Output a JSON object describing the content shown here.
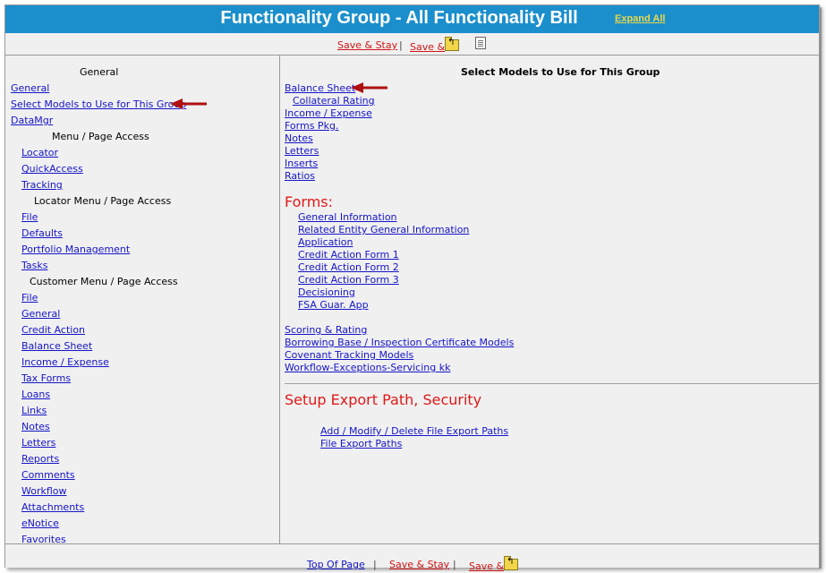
{
  "title": "Functionality Group - All Functionality Bill",
  "expand_all": "Expand All",
  "toolbar": {
    "save_stay": "Save & Stay",
    "sep": "|",
    "save": "Save &"
  },
  "left": {
    "general_heading": "General",
    "links_top": [
      "General",
      "Select Models to Use for This Group",
      "DataMgr"
    ],
    "menu_page_access": "Menu / Page Access",
    "menu_items": [
      "Locator",
      "QuickAccess",
      "Tracking"
    ],
    "locator_menu": "Locator Menu / Page Access",
    "locator_items": [
      "File",
      "Defaults",
      "Portfolio Management",
      "Tasks"
    ],
    "customer_menu": "Customer Menu / Page Access",
    "customer_items": [
      "File",
      "General",
      "Credit Action",
      "Balance Sheet",
      "Income / Expense",
      "Tax Forms",
      "Loans",
      "Links",
      "Notes",
      "Letters",
      "Reports",
      "Comments",
      "Workflow",
      "Attachments",
      "eNotice",
      "Favorites"
    ]
  },
  "right": {
    "heading": "Select Models to Use for This Group",
    "balance_sheet": "Balance Sheet",
    "collateral_rating": "Collateral Rating",
    "models": [
      "Income / Expense",
      "Forms Pkg.",
      "Notes",
      "Letters",
      "Inserts",
      "Ratios"
    ],
    "forms_heading": "Forms:",
    "forms": [
      "General Information",
      "Related Entity General Information",
      "Application",
      "Credit Action Form 1",
      "Credit Action Form 2",
      "Credit Action Form 3",
      "Decisioning",
      "FSA Guar. App"
    ],
    "more_models": [
      "Scoring & Rating",
      "Borrowing Base / Inspection Certificate Models",
      "Covenant Tracking Models",
      "Workflow-Exceptions-Servicing kk"
    ],
    "setup_heading": "Setup Export Path, Security",
    "export_links": [
      "Add / Modify / Delete File Export Paths",
      "File Export Paths"
    ]
  },
  "footer": {
    "top_of_page": "Top Of Page",
    "sep": "|",
    "save_stay": "Save & Stay",
    "save": "Save &"
  },
  "colors": {
    "title_bar": "#1b8fcc",
    "link": "#1515c8",
    "red_link": "#d11515",
    "arrow": "#b01010"
  }
}
